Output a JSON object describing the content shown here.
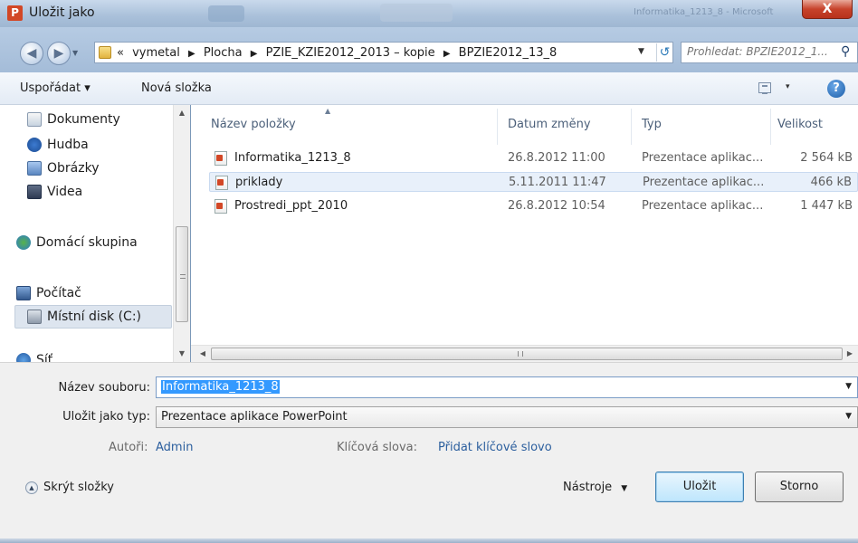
{
  "window": {
    "title": "Uložit jako",
    "app_icon": "P",
    "close_label": "X",
    "ghost_title": "Informatika_1213_8 - Microsoft"
  },
  "nav": {
    "back_icon": "back-arrow-icon",
    "forward_icon": "forward-arrow-icon"
  },
  "address": {
    "overflow": "«",
    "crumbs": [
      "vymetal",
      "Plocha",
      "PZIE_KZIE2012_2013 – kopie",
      "BPZIE2012_13_8"
    ],
    "separator": "▶"
  },
  "search": {
    "placeholder": "Prohledat: BPZIE2012_1..."
  },
  "toolbar": {
    "organize_label": "Uspořádat ▾",
    "new_folder_label": "Nová složka",
    "view_drop": "▾",
    "help_label": "?"
  },
  "navpane": {
    "items": [
      {
        "label": "Dokumenty",
        "icon": "documents-icon"
      },
      {
        "label": "Hudba",
        "icon": "music-icon"
      },
      {
        "label": "Obrázky",
        "icon": "pictures-icon"
      },
      {
        "label": "Videa",
        "icon": "videos-icon"
      },
      {
        "label": "Domácí skupina",
        "icon": "homegroup-icon"
      },
      {
        "label": "Počítač",
        "icon": "computer-icon"
      },
      {
        "label": "Místní disk (C:)",
        "icon": "local-disk-icon"
      },
      {
        "label": "Síť",
        "icon": "network-icon"
      }
    ]
  },
  "filelist": {
    "columns": {
      "name": "Název položky",
      "date": "Datum změny",
      "type": "Typ",
      "size": "Velikost"
    },
    "rows": [
      {
        "name": "Informatika_1213_8",
        "date": "26.8.2012 11:00",
        "type": "Prezentace aplikac...",
        "size": "2 564 kB"
      },
      {
        "name": "priklady",
        "date": "5.11.2011 11:47",
        "type": "Prezentace aplikac...",
        "size": "466 kB"
      },
      {
        "name": "Prostredi_ppt_2010",
        "date": "26.8.2012 10:54",
        "type": "Prezentace aplikac...",
        "size": "1 447 kB"
      }
    ]
  },
  "form": {
    "filename_label": "Název souboru:",
    "filename_value": "Informatika_1213_8",
    "type_label": "Uložit jako typ:",
    "type_value": "Prezentace aplikace PowerPoint",
    "authors_label": "Autoři:",
    "authors_value": "Admin",
    "keywords_label": "Klíčová slova:",
    "keywords_value": "Přidat klíčové slovo",
    "hide_folders_label": "Skrýt složky",
    "tools_label": "Nástroje",
    "save_label": "Uložit",
    "cancel_label": "Storno"
  },
  "colors": {
    "accent": "#3399ff",
    "link": "#2c5f9e",
    "ppt_icon": "#d24726"
  }
}
